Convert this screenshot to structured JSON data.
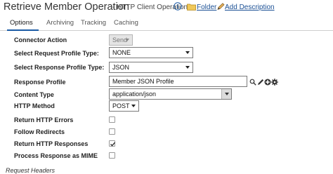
{
  "header": {
    "title": "Retrieve Member Operation",
    "subtitle": "- HTTP Client Operation",
    "folder_link": "Folder",
    "description_link": "Add Description"
  },
  "tabs": [
    {
      "label": "Options",
      "active": true
    },
    {
      "label": "Archiving",
      "active": false
    },
    {
      "label": "Tracking",
      "active": false
    },
    {
      "label": "Caching",
      "active": false
    }
  ],
  "form": {
    "connector_action": {
      "label": "Connector Action",
      "value": "Send"
    },
    "request_profile_type": {
      "label": "Select Request Profile Type:",
      "value": "NONE"
    },
    "response_profile_type": {
      "label": "Select Response Profile Type:",
      "value": "JSON"
    },
    "response_profile": {
      "label": "Response Profile",
      "value": "Member JSON Profile"
    },
    "content_type": {
      "label": "Content Type",
      "value": "application/json"
    },
    "http_method": {
      "label": "HTTP Method",
      "value": "POST"
    },
    "return_http_errors": {
      "label": "Return HTTP Errors",
      "checked": false
    },
    "follow_redirects": {
      "label": "Follow Redirects",
      "checked": false
    },
    "return_http_responses": {
      "label": "Return HTTP Responses",
      "checked": true
    },
    "process_response_mime": {
      "label": "Process Response as MIME",
      "checked": false
    },
    "request_headers": {
      "label": "Request Headers"
    }
  },
  "colors": {
    "link": "#1a4f94",
    "tab_accent": "#1a5aa5"
  }
}
